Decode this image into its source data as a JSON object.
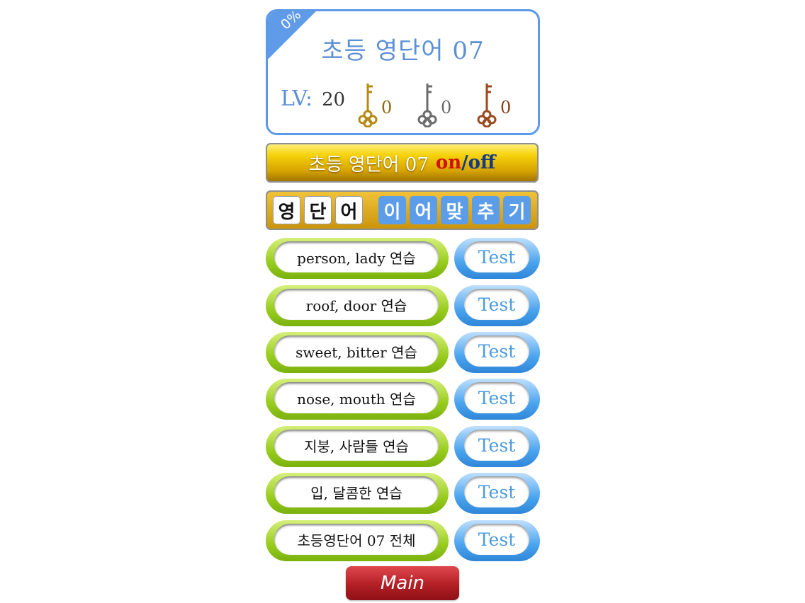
{
  "header": {
    "progress": "0%",
    "title": "초등 영단어 07",
    "lv_label": "LV:",
    "lv_value": "20",
    "keys": [
      {
        "icon": "gold-key-icon",
        "color": "#b58a12",
        "count": "0"
      },
      {
        "icon": "silver-key-icon",
        "color": "#6c6c6c",
        "count": "0"
      },
      {
        "icon": "bronze-key-icon",
        "color": "#9a4a1e",
        "count": "0"
      }
    ]
  },
  "onoff": {
    "label": "초등 영단어 07",
    "on": "on",
    "slash": "/",
    "off": "off"
  },
  "mode": {
    "word_tiles": [
      "영",
      "단",
      "어"
    ],
    "game_tiles": [
      "이",
      "어",
      "맞",
      "추",
      "기"
    ]
  },
  "lessons": [
    {
      "label": "person, lady 연습",
      "test": "Test"
    },
    {
      "label": "roof, door 연습",
      "test": "Test"
    },
    {
      "label": "sweet, bitter 연습",
      "test": "Test"
    },
    {
      "label": "nose, mouth 연습",
      "test": "Test"
    },
    {
      "label": "지붕, 사람들 연습",
      "test": "Test"
    },
    {
      "label": "입, 달콤한 연습",
      "test": "Test"
    },
    {
      "label": "초등영단어 07 전체",
      "test": "Test"
    }
  ],
  "main_button": "Main",
  "colors": {
    "accent_blue": "#5b9ae6",
    "green": "#98cc1e",
    "red": "#b31f26",
    "gold": "#f7d30c"
  }
}
